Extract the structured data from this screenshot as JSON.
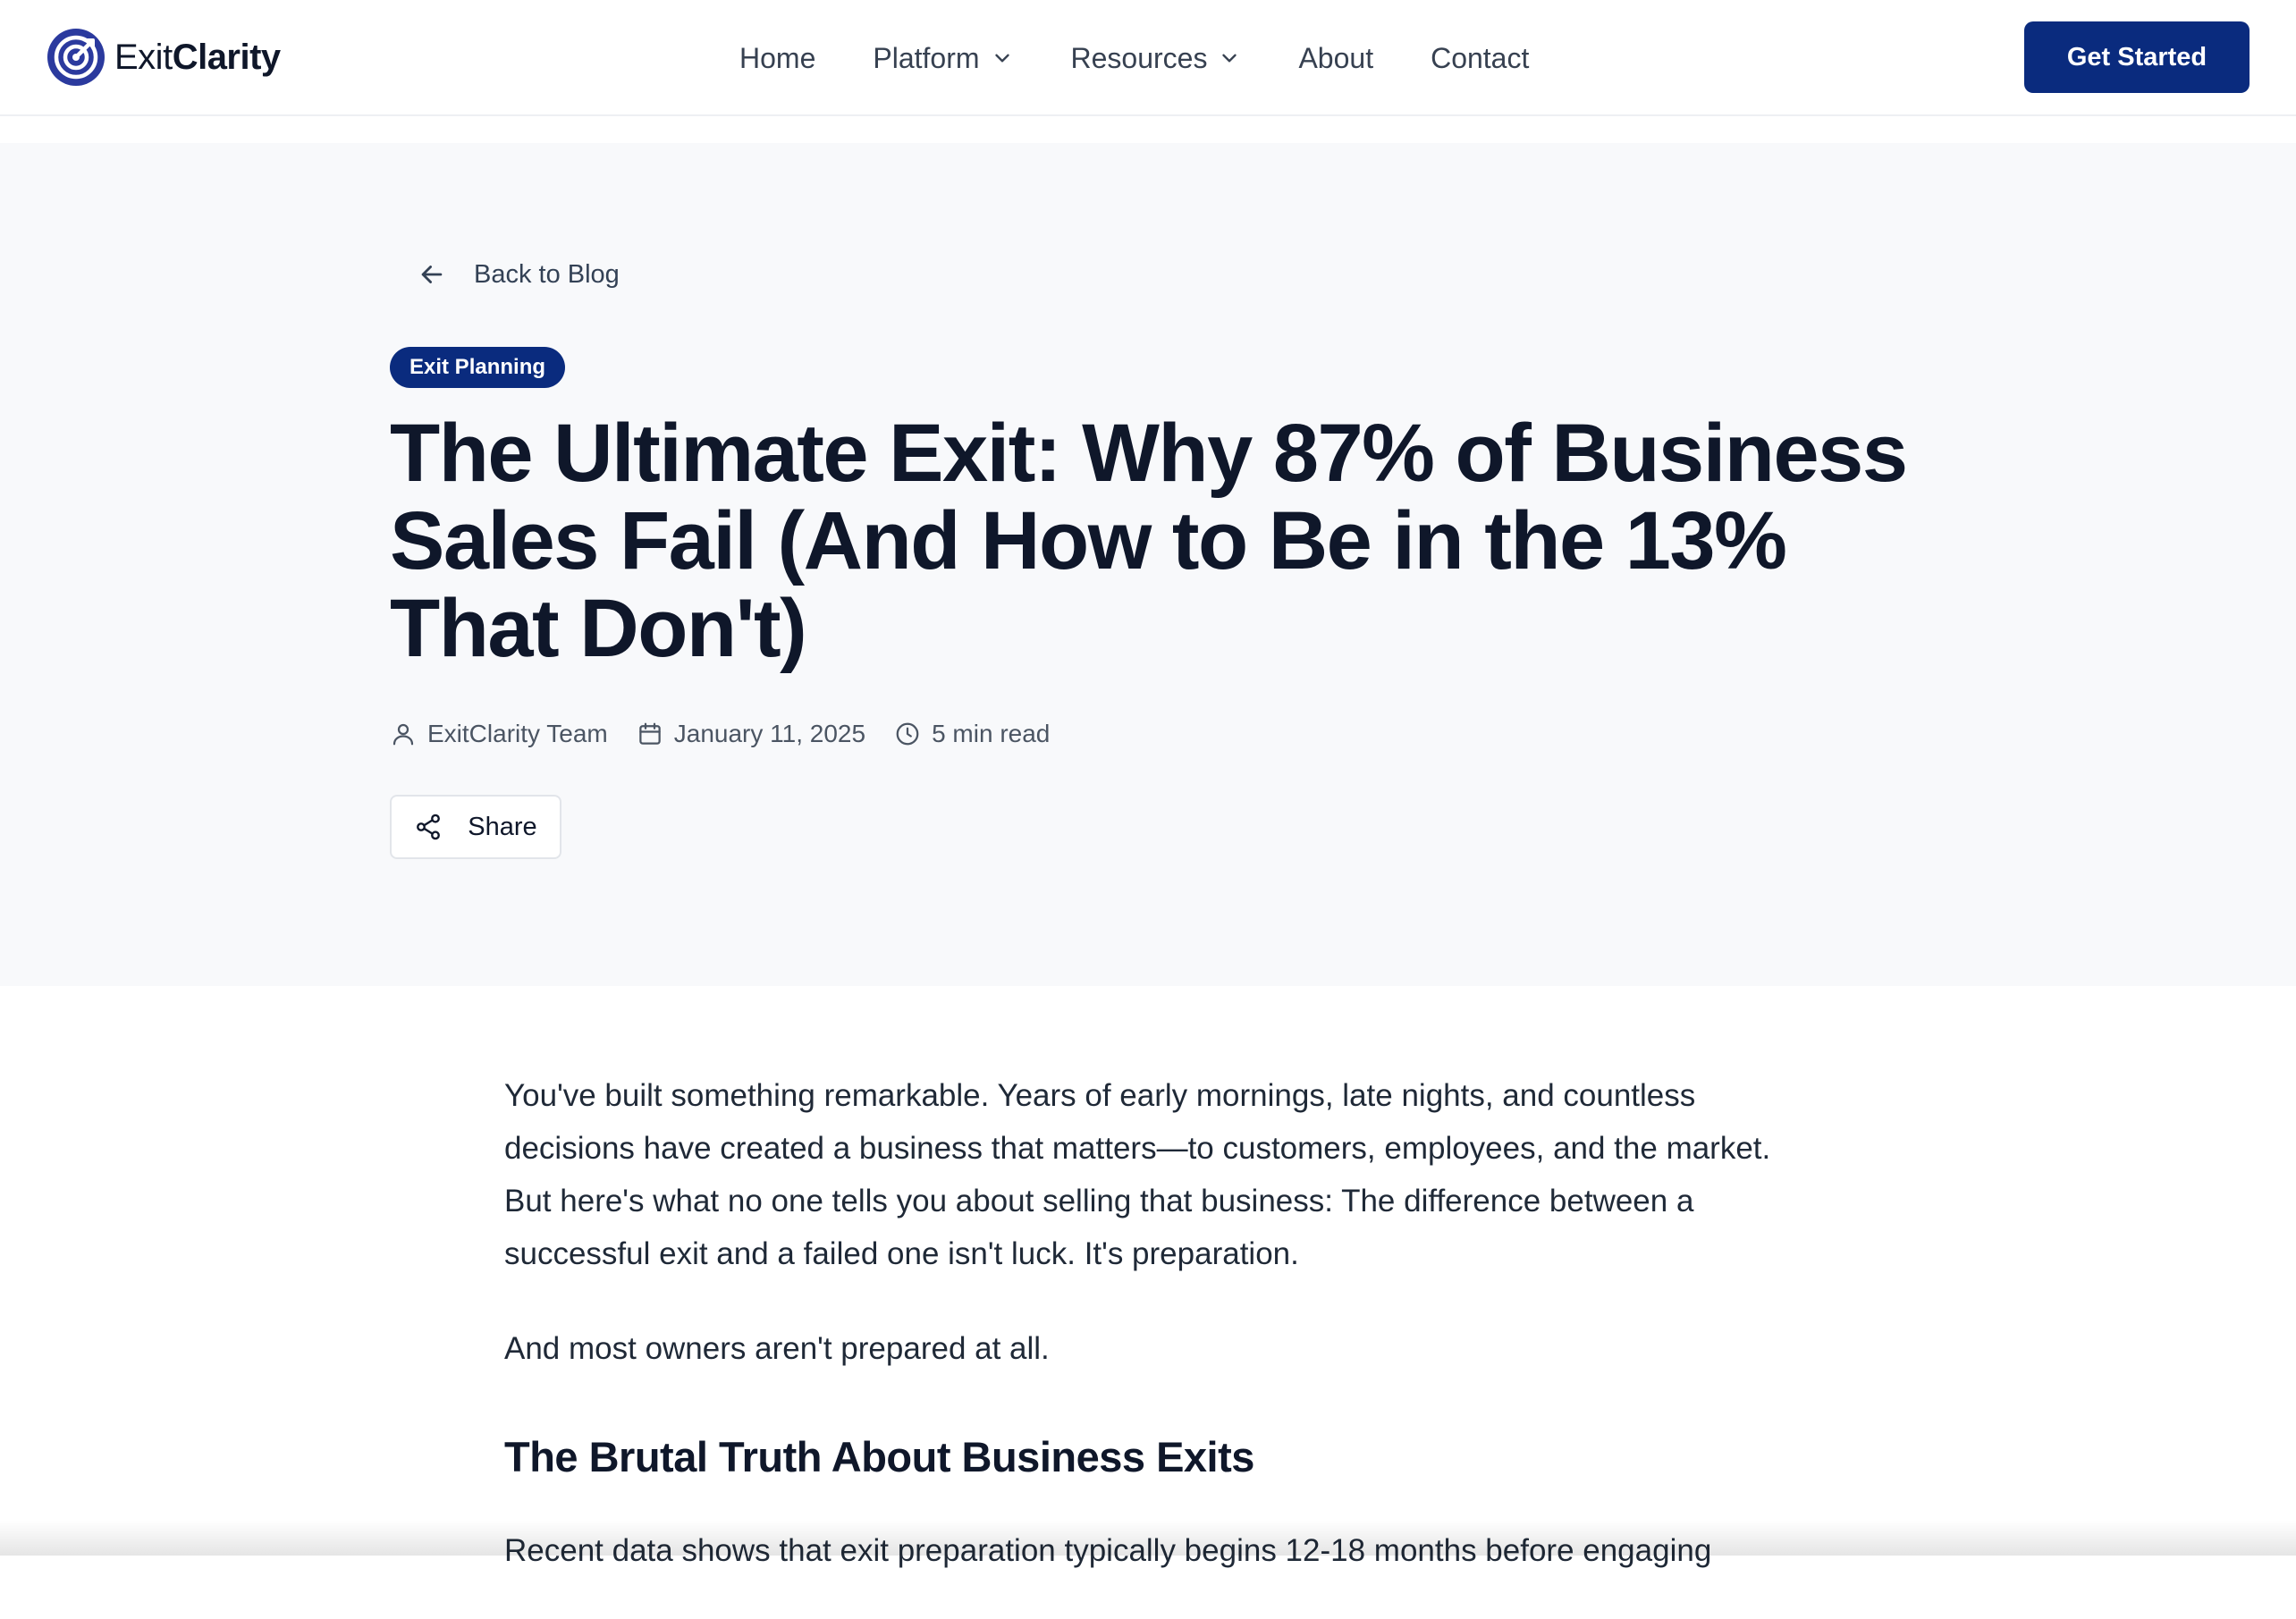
{
  "brand": {
    "name_regular": "Exit",
    "name_bold": "Clarity",
    "accent_color": "#0a2b7e",
    "logo_icon": "target-icon"
  },
  "nav": {
    "items": [
      {
        "label": "Home",
        "has_dropdown": false
      },
      {
        "label": "Platform",
        "has_dropdown": true
      },
      {
        "label": "Resources",
        "has_dropdown": true
      },
      {
        "label": "About",
        "has_dropdown": false
      },
      {
        "label": "Contact",
        "has_dropdown": false
      }
    ],
    "cta_label": "Get Started"
  },
  "hero": {
    "back_label": "Back to Blog",
    "category": "Exit Planning",
    "title": "The Ultimate Exit: Why 87% of Business Sales Fail (And How to Be in the 13% That Don't)",
    "author": "ExitClarity Team",
    "date": "January 11, 2025",
    "read_time": "5 min read",
    "share_label": "Share"
  },
  "article": {
    "intro": "You've built something remarkable. Years of early mornings, late nights, and countless decisions have created a business that matters—to customers, employees, and the market. But here's what no one tells you about selling that business: The difference between a successful exit and a failed one isn't luck. It's preparation.",
    "intro_2": "And most owners aren't prepared at all.",
    "heading_1": "The Brutal Truth About Business Exits",
    "para_3": "Recent data shows that exit preparation typically begins 12-18 months before engaging"
  }
}
